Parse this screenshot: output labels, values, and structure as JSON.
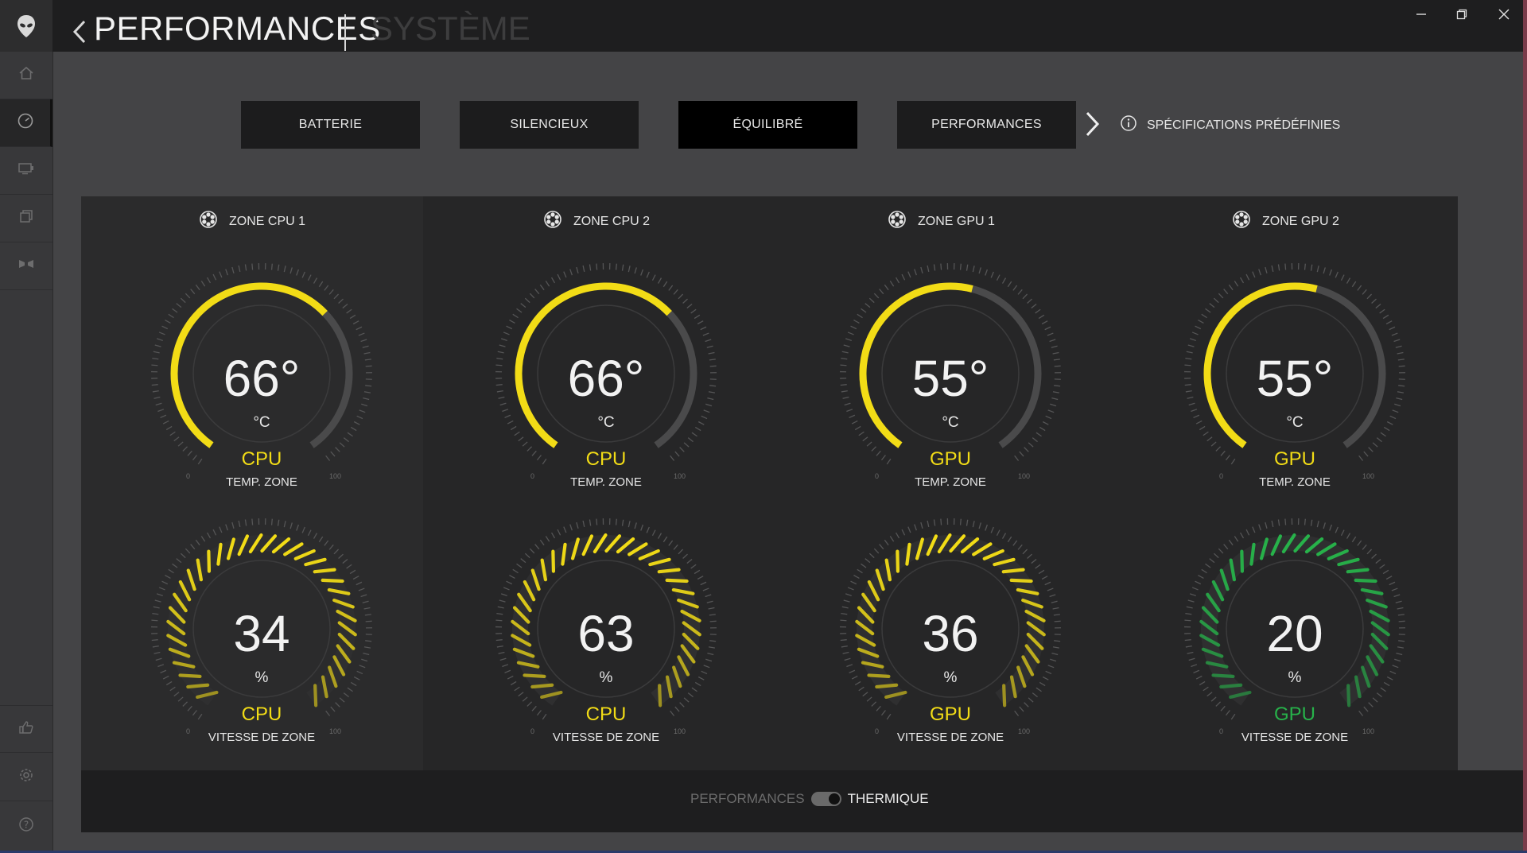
{
  "titlebar": {
    "title": "PERFORMANCES",
    "subtitle": "SYSTÈME",
    "logo_icon": "alien-head-icon",
    "back_icon": "chevron-left-icon",
    "window_controls": [
      "minimize-icon",
      "restore-icon",
      "close-icon"
    ]
  },
  "sidebar": {
    "items": [
      {
        "icon": "home-icon"
      },
      {
        "icon": "speedometer-icon",
        "active": true
      },
      {
        "icon": "display-icon"
      },
      {
        "icon": "layers-icon"
      },
      {
        "icon": "speaker-icon"
      }
    ],
    "bottom_items": [
      {
        "icon": "thumbs-up-icon"
      },
      {
        "icon": "gear-icon"
      },
      {
        "icon": "help-icon"
      }
    ]
  },
  "presets": {
    "items": [
      {
        "label": "BATTERIE"
      },
      {
        "label": "SILENCIEUX"
      },
      {
        "label": "ÉQUILIBRÉ",
        "active": true
      },
      {
        "label": "PERFORMANCES"
      }
    ],
    "next_icon": "chevron-right-icon",
    "specs_icon": "info-icon",
    "specs_label": "SPÉCIFICATIONS PRÉDÉFINIES"
  },
  "zones": [
    {
      "title": "ZONE CPU 1",
      "fan_icon": "fan-icon",
      "temp": {
        "value": "66°",
        "unit": "°C",
        "label": "CPU",
        "sub": "TEMP. ZONE",
        "min": "0",
        "max": "100",
        "level": 66
      },
      "speed": {
        "value": "34",
        "unit": "%",
        "label": "CPU",
        "sub": "VITESSE DE ZONE",
        "min": "0",
        "max": "100",
        "level": 34
      }
    },
    {
      "title": "ZONE CPU 2",
      "fan_icon": "fan-icon",
      "temp": {
        "value": "66°",
        "unit": "°C",
        "label": "CPU",
        "sub": "TEMP. ZONE",
        "min": "0",
        "max": "100",
        "level": 66
      },
      "speed": {
        "value": "63",
        "unit": "%",
        "label": "CPU",
        "sub": "VITESSE DE ZONE",
        "min": "0",
        "max": "100",
        "level": 63
      }
    },
    {
      "title": "ZONE GPU 1",
      "fan_icon": "fan-icon",
      "temp": {
        "value": "55°",
        "unit": "°C",
        "label": "GPU",
        "sub": "TEMP. ZONE",
        "min": "0",
        "max": "100",
        "level": 55
      },
      "speed": {
        "value": "36",
        "unit": "%",
        "label": "GPU",
        "sub": "VITESSE DE ZONE",
        "min": "0",
        "max": "100",
        "level": 36
      }
    },
    {
      "title": "ZONE GPU 2",
      "fan_icon": "fan-icon",
      "temp": {
        "value": "55°",
        "unit": "°C",
        "label": "GPU",
        "sub": "TEMP. ZONE",
        "min": "0",
        "max": "100",
        "level": 55
      },
      "speed": {
        "value": "20",
        "unit": "%",
        "label": "GPU",
        "sub": "VITESSE DE ZONE",
        "min": "0",
        "max": "100",
        "level": 20
      }
    }
  ],
  "colors": {
    "yellow": "#f2dc16",
    "green": "#27b24a",
    "track": "#4a4a4b",
    "tick": "#555556"
  },
  "gauge_colors": {
    "temp": [
      "#f2dc16",
      "#f2dc16",
      "#f2dc16",
      "#f2dc16"
    ],
    "speed": [
      "#f2dc16",
      "#f2dc16",
      "#f2dc16",
      "#27b24a"
    ]
  },
  "footer": {
    "mode_left": "PERFORMANCES",
    "mode_right": "THERMIQUE",
    "toggle_state": "THERMIQUE"
  }
}
